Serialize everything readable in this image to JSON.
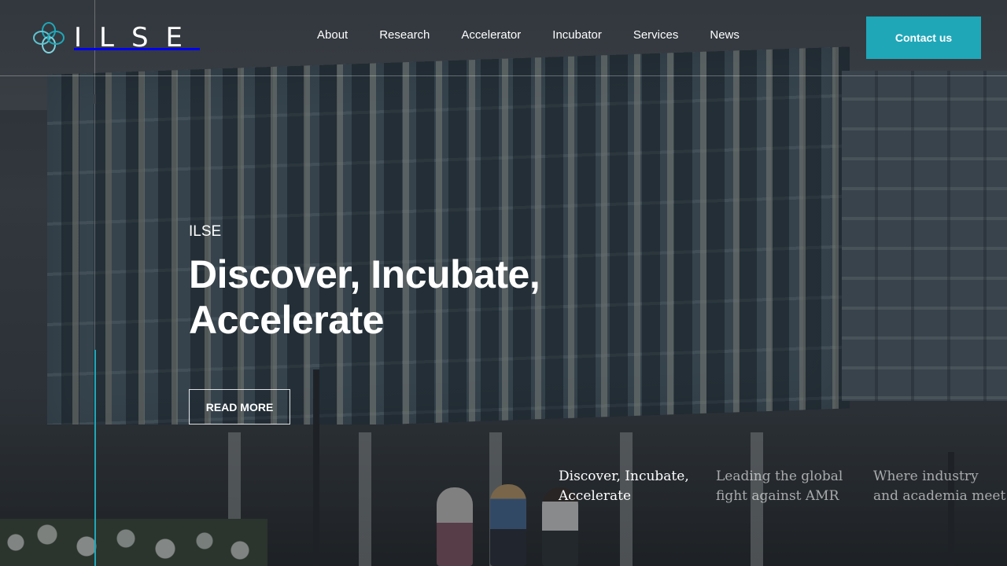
{
  "header": {
    "logo_text": "ILSE",
    "nav": [
      {
        "label": "About"
      },
      {
        "label": "Research"
      },
      {
        "label": "Accelerator"
      },
      {
        "label": "Incubator"
      },
      {
        "label": "Services"
      },
      {
        "label": "News"
      }
    ],
    "contact_label": "Contact us"
  },
  "hero": {
    "eyebrow": "ILSE",
    "headline": "Discover, Incubate, Accelerate",
    "read_more_label": "READ MORE"
  },
  "slides": [
    {
      "label": "Discover, Incubate, Accelerate",
      "active": true
    },
    {
      "label": "Leading the global fight against AMR",
      "active": false
    },
    {
      "label": "Where industry and academia meet",
      "active": false
    }
  ],
  "colors": {
    "accent": "#1fa7b8",
    "text": "#ffffff",
    "overlay": "#161a1e"
  },
  "icons": {
    "logo": "flower-logo-icon"
  }
}
